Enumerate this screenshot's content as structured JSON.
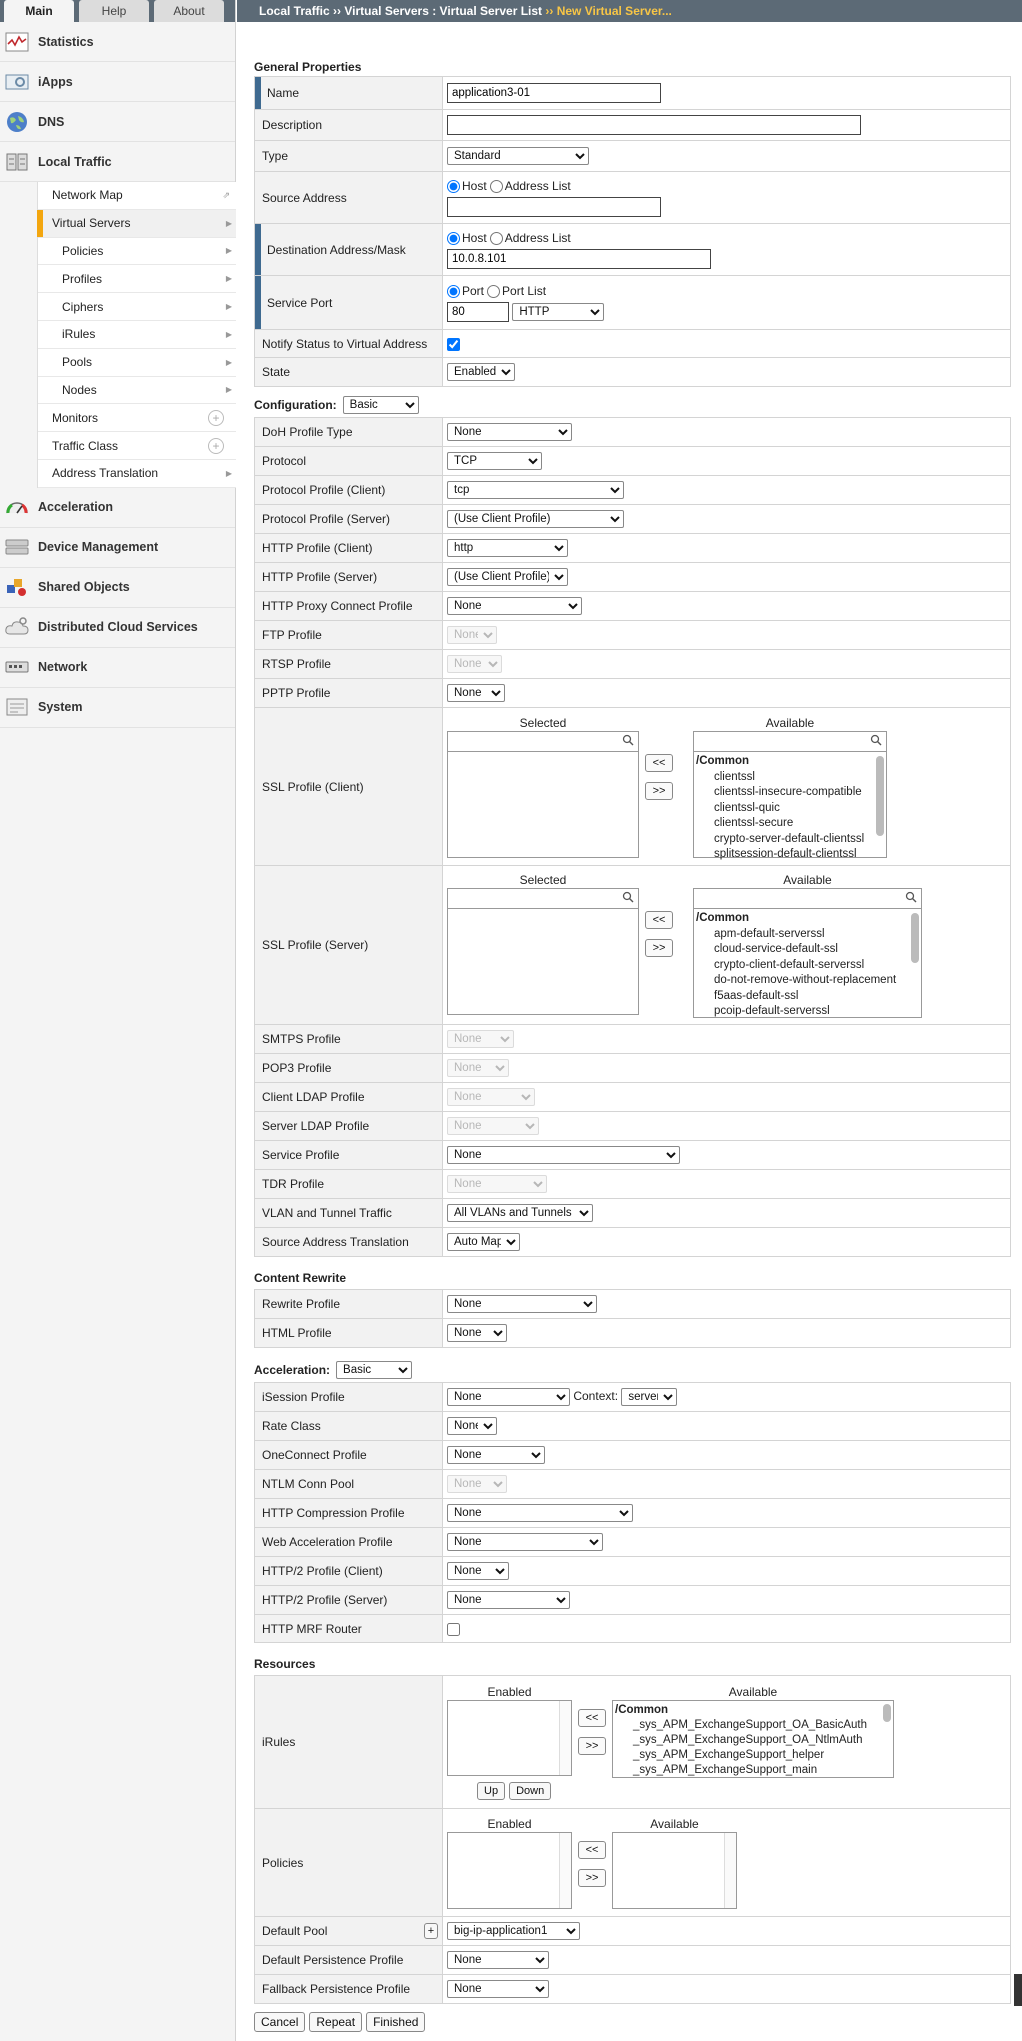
{
  "tabs": [
    "Main",
    "Help",
    "About"
  ],
  "breadcrumb": {
    "part1": "Local Traffic",
    "sep": "››",
    "part2": "Virtual Servers : Virtual Server List",
    "part3": "New Virtual Server..."
  },
  "nav": {
    "sections_top": [
      {
        "label": "Statistics",
        "icon": "statistics-icon"
      },
      {
        "label": "iApps",
        "icon": "iapps-icon"
      },
      {
        "label": "DNS",
        "icon": "dns-globe-icon"
      },
      {
        "label": "Local Traffic",
        "icon": "local-traffic-icon"
      }
    ],
    "local_traffic": [
      {
        "label": "Network Map"
      },
      {
        "label": "Virtual Servers"
      },
      {
        "label": "Policies"
      },
      {
        "label": "Profiles"
      },
      {
        "label": "Ciphers"
      },
      {
        "label": "iRules"
      },
      {
        "label": "Pools"
      },
      {
        "label": "Nodes"
      },
      {
        "label": "Monitors"
      },
      {
        "label": "Traffic Class"
      },
      {
        "label": "Address Translation"
      }
    ],
    "sections_bottom": [
      {
        "label": "Acceleration",
        "icon": "acceleration-gauge-icon"
      },
      {
        "label": "Device Management",
        "icon": "device-management-icon"
      },
      {
        "label": "Shared Objects",
        "icon": "shared-objects-icon"
      },
      {
        "label": "Distributed Cloud Services",
        "icon": "cloud-services-icon"
      },
      {
        "label": "Network",
        "icon": "network-icon"
      },
      {
        "label": "System",
        "icon": "system-icon"
      }
    ]
  },
  "general": {
    "title": "General Properties",
    "name_label": "Name",
    "name_value": "application3-01",
    "desc_label": "Description",
    "desc_value": "",
    "type_label": "Type",
    "type_value": "Standard",
    "source_label": "Source Address",
    "host": "Host",
    "address_list": "Address List",
    "source_value": "",
    "dest_label": "Destination Address/Mask",
    "dest_value": "10.0.8.101",
    "port_label": "Service Port",
    "port": "Port",
    "port_list": "Port List",
    "port_value": "80",
    "port_service": "HTTP",
    "notify_label": "Notify Status to Virtual Address",
    "state_label": "State",
    "state_value": "Enabled"
  },
  "configuration": {
    "title": "Configuration:",
    "mode": "Basic",
    "rows": [
      {
        "label": "DoH Profile Type",
        "value": "None",
        "w": 125
      },
      {
        "label": "Protocol",
        "value": "TCP",
        "w": 95
      },
      {
        "label": "Protocol Profile (Client)",
        "value": "tcp",
        "w": 177
      },
      {
        "label": "Protocol Profile (Server)",
        "value": "(Use Client Profile)",
        "w": 177
      },
      {
        "label": "HTTP Profile (Client)",
        "value": "http",
        "w": 121
      },
      {
        "label": "HTTP Profile (Server)",
        "value": "(Use Client Profile)",
        "w": 121
      },
      {
        "label": "HTTP Proxy Connect Profile",
        "value": "None",
        "w": 135
      },
      {
        "label": "FTP Profile",
        "value": "None",
        "w": 50,
        "disabled": true
      },
      {
        "label": "RTSP Profile",
        "value": "None",
        "w": 55,
        "disabled": true
      },
      {
        "label": "PPTP Profile",
        "value": "None",
        "w": 58
      }
    ],
    "ssl_client": {
      "label": "SSL Profile (Client)",
      "selected": "Selected",
      "available": "Available",
      "group": "/Common",
      "items": [
        "clientssl",
        "clientssl-insecure-compatible",
        "clientssl-quic",
        "clientssl-secure",
        "crypto-server-default-clientssl",
        "splitsession-default-clientssl"
      ]
    },
    "ssl_server": {
      "label": "SSL Profile (Server)",
      "selected": "Selected",
      "available": "Available",
      "group": "/Common",
      "items": [
        "apm-default-serverssl",
        "cloud-service-default-ssl",
        "crypto-client-default-serverssl",
        "do-not-remove-without-replacement",
        "f5aas-default-ssl",
        "pcoip-default-serverssl"
      ]
    },
    "rows2": [
      {
        "label": "SMTPS Profile",
        "value": "None",
        "w": 67,
        "disabled": true
      },
      {
        "label": "POP3 Profile",
        "value": "None",
        "w": 62,
        "disabled": true
      },
      {
        "label": "Client LDAP Profile",
        "value": "None",
        "w": 88,
        "disabled": true
      },
      {
        "label": "Server LDAP Profile",
        "value": "None",
        "w": 92,
        "disabled": true
      },
      {
        "label": "Service Profile",
        "value": "None",
        "w": 233
      },
      {
        "label": "TDR Profile",
        "value": "None",
        "w": 100,
        "disabled": true
      },
      {
        "label": "VLAN and Tunnel Traffic",
        "value": "All VLANs and Tunnels",
        "w": 146
      },
      {
        "label": "Source Address Translation",
        "value": "Auto Map",
        "w": 73
      }
    ]
  },
  "content_rewrite": {
    "title": "Content Rewrite",
    "rows": [
      {
        "label": "Rewrite Profile",
        "value": "None",
        "w": 150
      },
      {
        "label": "HTML Profile",
        "value": "None",
        "w": 60
      }
    ]
  },
  "acceleration": {
    "title": "Acceleration:",
    "mode": "Basic",
    "isession_label": "iSession Profile",
    "isession_value": "None",
    "context_label": "Context:",
    "context_value": "server",
    "rows": [
      {
        "label": "Rate Class",
        "value": "None",
        "w": 50
      },
      {
        "label": "OneConnect Profile",
        "value": "None",
        "w": 98
      },
      {
        "label": "NTLM Conn Pool",
        "value": "None",
        "w": 60,
        "disabled": true
      },
      {
        "label": "HTTP Compression Profile",
        "value": "None",
        "w": 186
      },
      {
        "label": "Web Acceleration Profile",
        "value": "None",
        "w": 156
      },
      {
        "label": "HTTP/2 Profile (Client)",
        "value": "None",
        "w": 62
      },
      {
        "label": "HTTP/2 Profile (Server)",
        "value": "None",
        "w": 123
      }
    ],
    "mrf_label": "HTTP MRF Router"
  },
  "resources": {
    "title": "Resources",
    "irules": {
      "label": "iRules",
      "enabled": "Enabled",
      "available": "Available",
      "group": "/Common",
      "items": [
        "_sys_APM_ExchangeSupport_OA_BasicAuth",
        "_sys_APM_ExchangeSupport_OA_NtlmAuth",
        "_sys_APM_ExchangeSupport_helper",
        "_sys_APM_ExchangeSupport_main"
      ],
      "up": "Up",
      "down": "Down"
    },
    "policies": {
      "label": "Policies",
      "enabled": "Enabled",
      "available": "Available"
    },
    "pool_label": "Default Pool",
    "pool_plus": "+",
    "pool_value": "big-ip-application1",
    "persist_label": "Default Persistence Profile",
    "persist_value": "None",
    "fallback_label": "Fallback Persistence Profile",
    "fallback_value": "None"
  },
  "buttons": {
    "cancel": "Cancel",
    "repeat": "Repeat",
    "finished": "Finished"
  },
  "move_left": "<<",
  "move_right": ">>",
  "colors": {
    "header": "#5c6a76",
    "required_bar": "#3f6a90",
    "active_nav": "#f3a60f",
    "breadcrumb_current": "#f7c546"
  }
}
